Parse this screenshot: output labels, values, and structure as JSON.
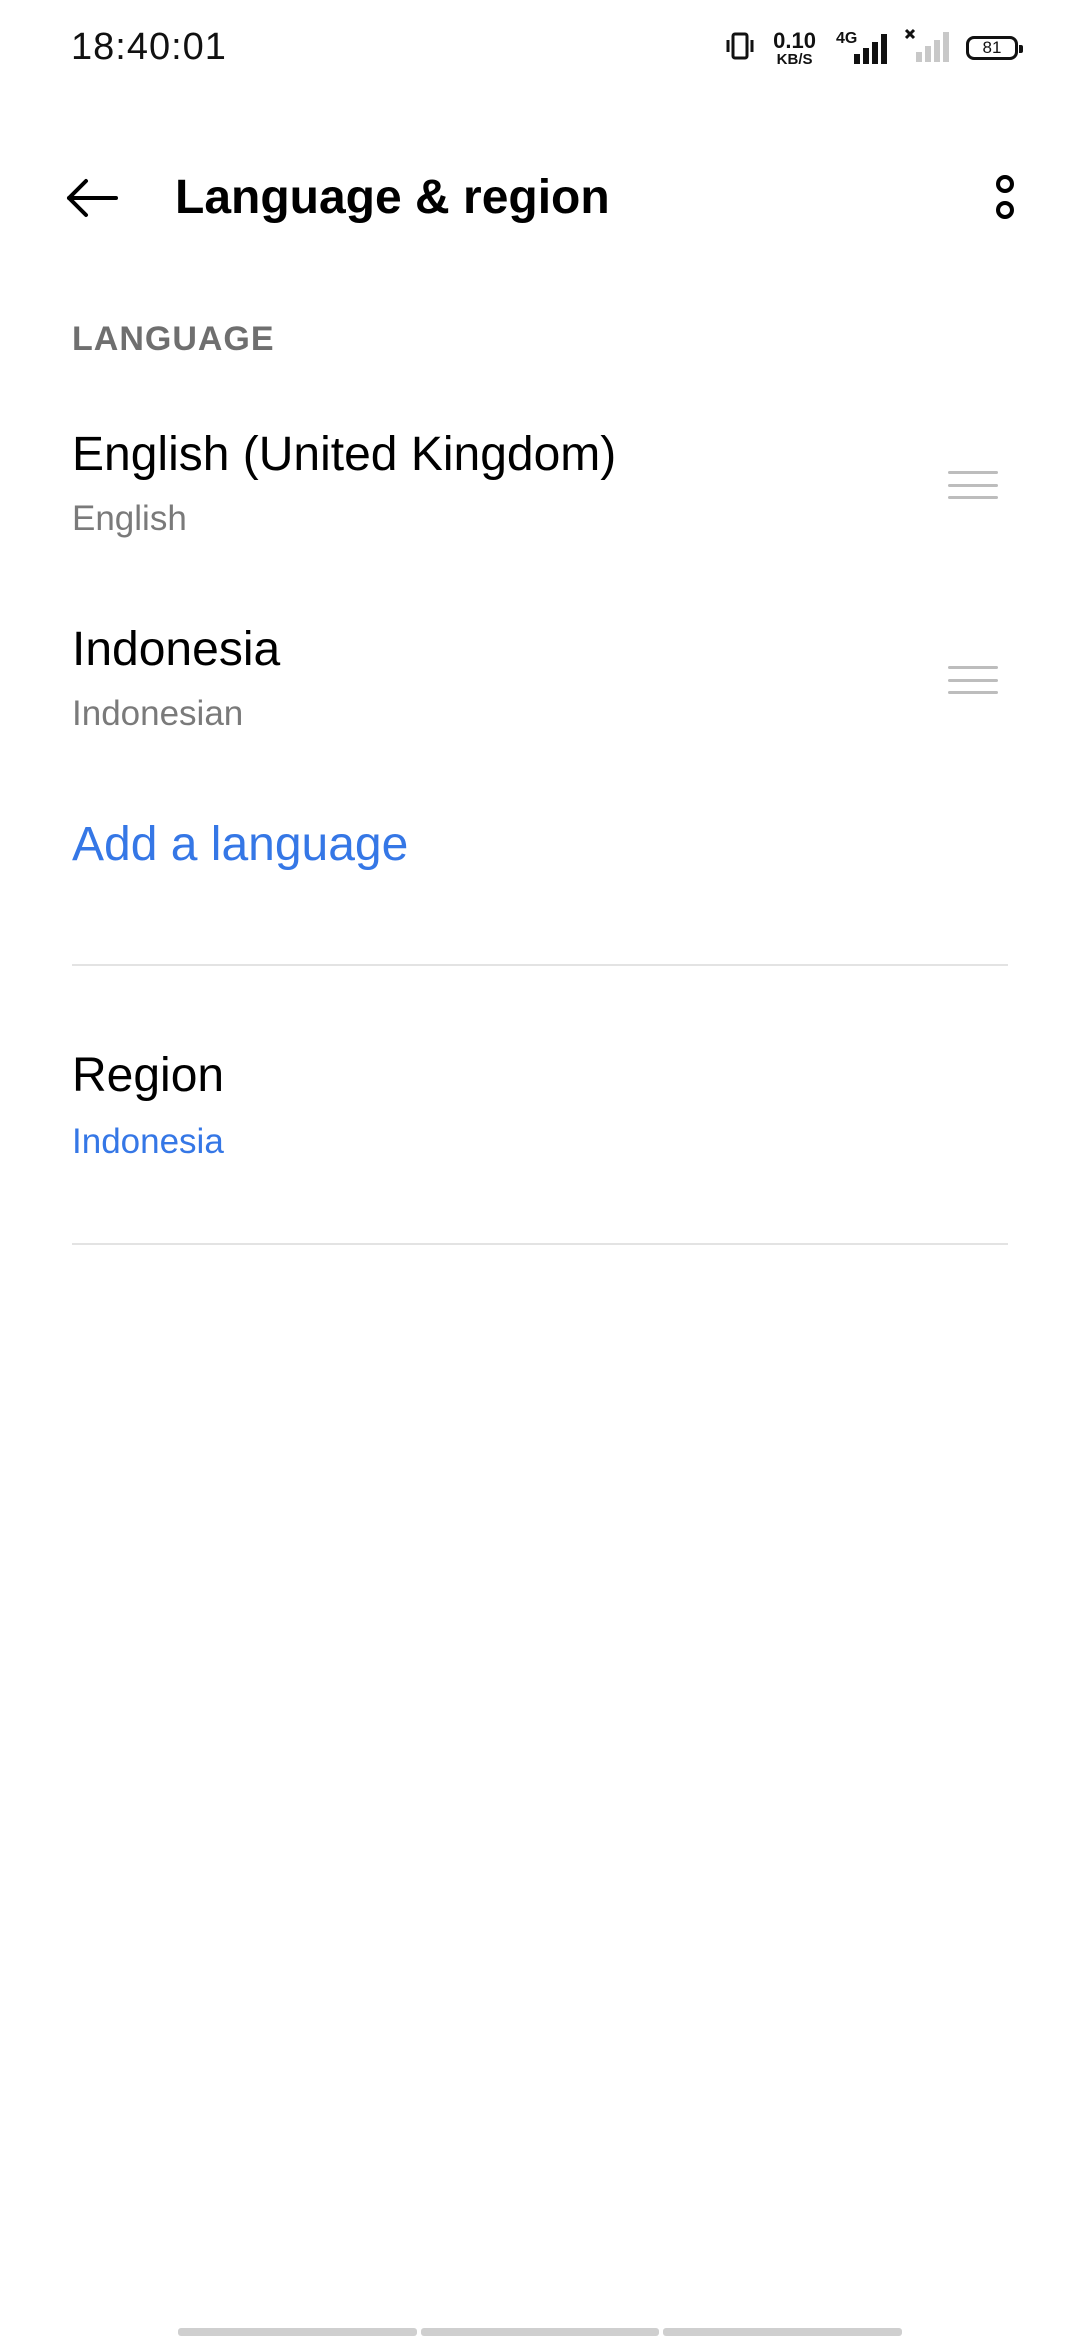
{
  "status_bar": {
    "time": "18:40:01",
    "net_speed_value": "0.10",
    "net_speed_unit": "KB/S",
    "network_type": "4G",
    "battery_level": "81",
    "icons": [
      "vibrate-icon",
      "network-speed",
      "signal-4g-icon",
      "signal-no-service-icon",
      "battery-icon"
    ]
  },
  "app_bar": {
    "title": "Language & region",
    "back_icon": "arrow-left-icon",
    "more_icon": "more-vertical-icon"
  },
  "language_section": {
    "header": "LANGUAGE",
    "items": [
      {
        "name": "English (United Kingdom)",
        "subtitle": "English"
      },
      {
        "name": "Indonesia",
        "subtitle": "Indonesian"
      }
    ],
    "add_label": "Add a language"
  },
  "region": {
    "label": "Region",
    "value": "Indonesia"
  },
  "colors": {
    "accent": "#3577e6",
    "section_header": "#6f6f6f",
    "divider": "#e3e3e3",
    "secondary_text": "#7a7a7a"
  }
}
